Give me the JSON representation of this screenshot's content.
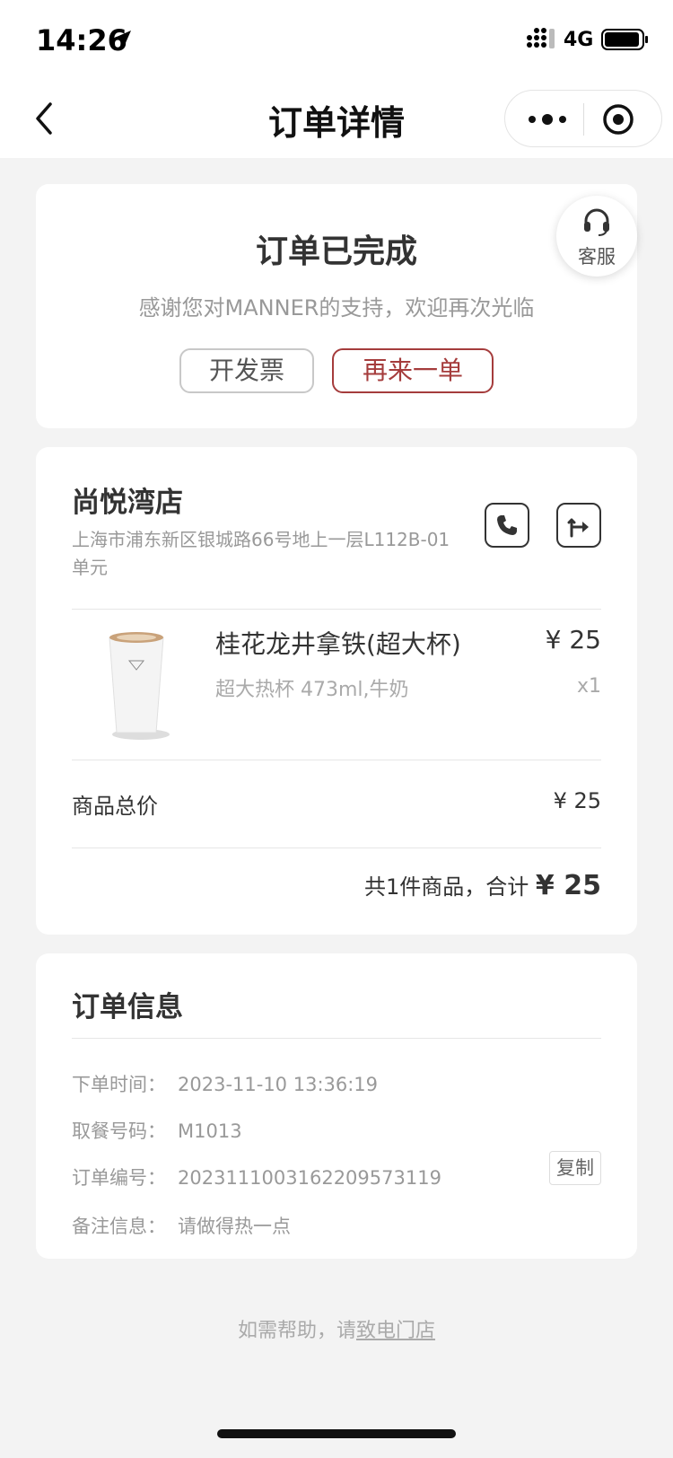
{
  "status_bar": {
    "time": "14:26",
    "network": "4G"
  },
  "nav": {
    "title": "订单详情"
  },
  "order_status": {
    "title": "订单已完成",
    "subtitle": "感谢您对MANNER的支持，欢迎再次光临",
    "invoice_button": "开发票",
    "reorder_button": "再来一单",
    "customer_service_label": "客服"
  },
  "store": {
    "name": "尚悦湾店",
    "address": "上海市浦东新区银城路66号地上一层L112B-01单元"
  },
  "item": {
    "name": "桂花龙井拿铁(超大杯)",
    "spec": "超大热杯 473ml,牛奶",
    "price": "¥ 25",
    "quantity": "x1"
  },
  "totals": {
    "subtotal_label": "商品总价",
    "subtotal_value": "¥ 25",
    "summary_text": "共1件商品，合计",
    "total_value": "¥ 25"
  },
  "order_info": {
    "title": "订单信息",
    "rows": [
      {
        "label": "下单时间：",
        "value": "2023-11-10 13:36:19"
      },
      {
        "label": "取餐号码：",
        "value": "M1013"
      },
      {
        "label": "订单编号：",
        "value": "2023111003162209573119"
      },
      {
        "label": "备注信息：",
        "value": "请做得热一点"
      }
    ],
    "copy_button": "复制"
  },
  "help": {
    "prefix": "如需帮助，请",
    "link": "致电门店"
  },
  "colors": {
    "accent": "#a53c3c",
    "background": "#f3f3f3"
  }
}
